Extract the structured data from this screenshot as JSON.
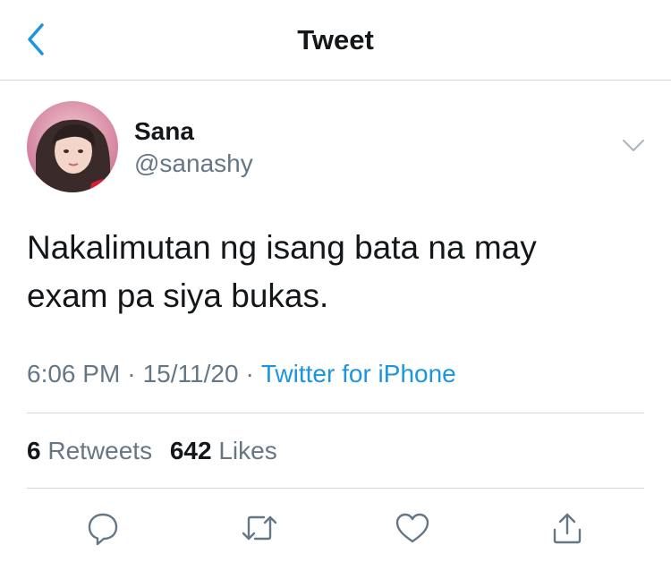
{
  "nav": {
    "title": "Tweet",
    "back_icon": "chevron-left-icon"
  },
  "colors": {
    "accent": "#1b95e0",
    "text": "#14171a",
    "muted": "#657786",
    "divider": "#d3d8dc"
  },
  "tweet": {
    "author_name": "Sana",
    "author_handle": "@sanashy",
    "text": "Nakalimutan ng isang bata na may exam pa siya bukas.",
    "time": "6:06 PM",
    "date": "15/11/20",
    "separator": "·",
    "source": "Twitter for iPhone"
  },
  "stats": {
    "retweets_count": "6",
    "retweets_label": "Retweets",
    "likes_count": "642",
    "likes_label": "Likes"
  },
  "actions": [
    {
      "icon": "reply-icon"
    },
    {
      "icon": "retweet-icon"
    },
    {
      "icon": "like-heart-icon"
    },
    {
      "icon": "share-icon"
    }
  ]
}
